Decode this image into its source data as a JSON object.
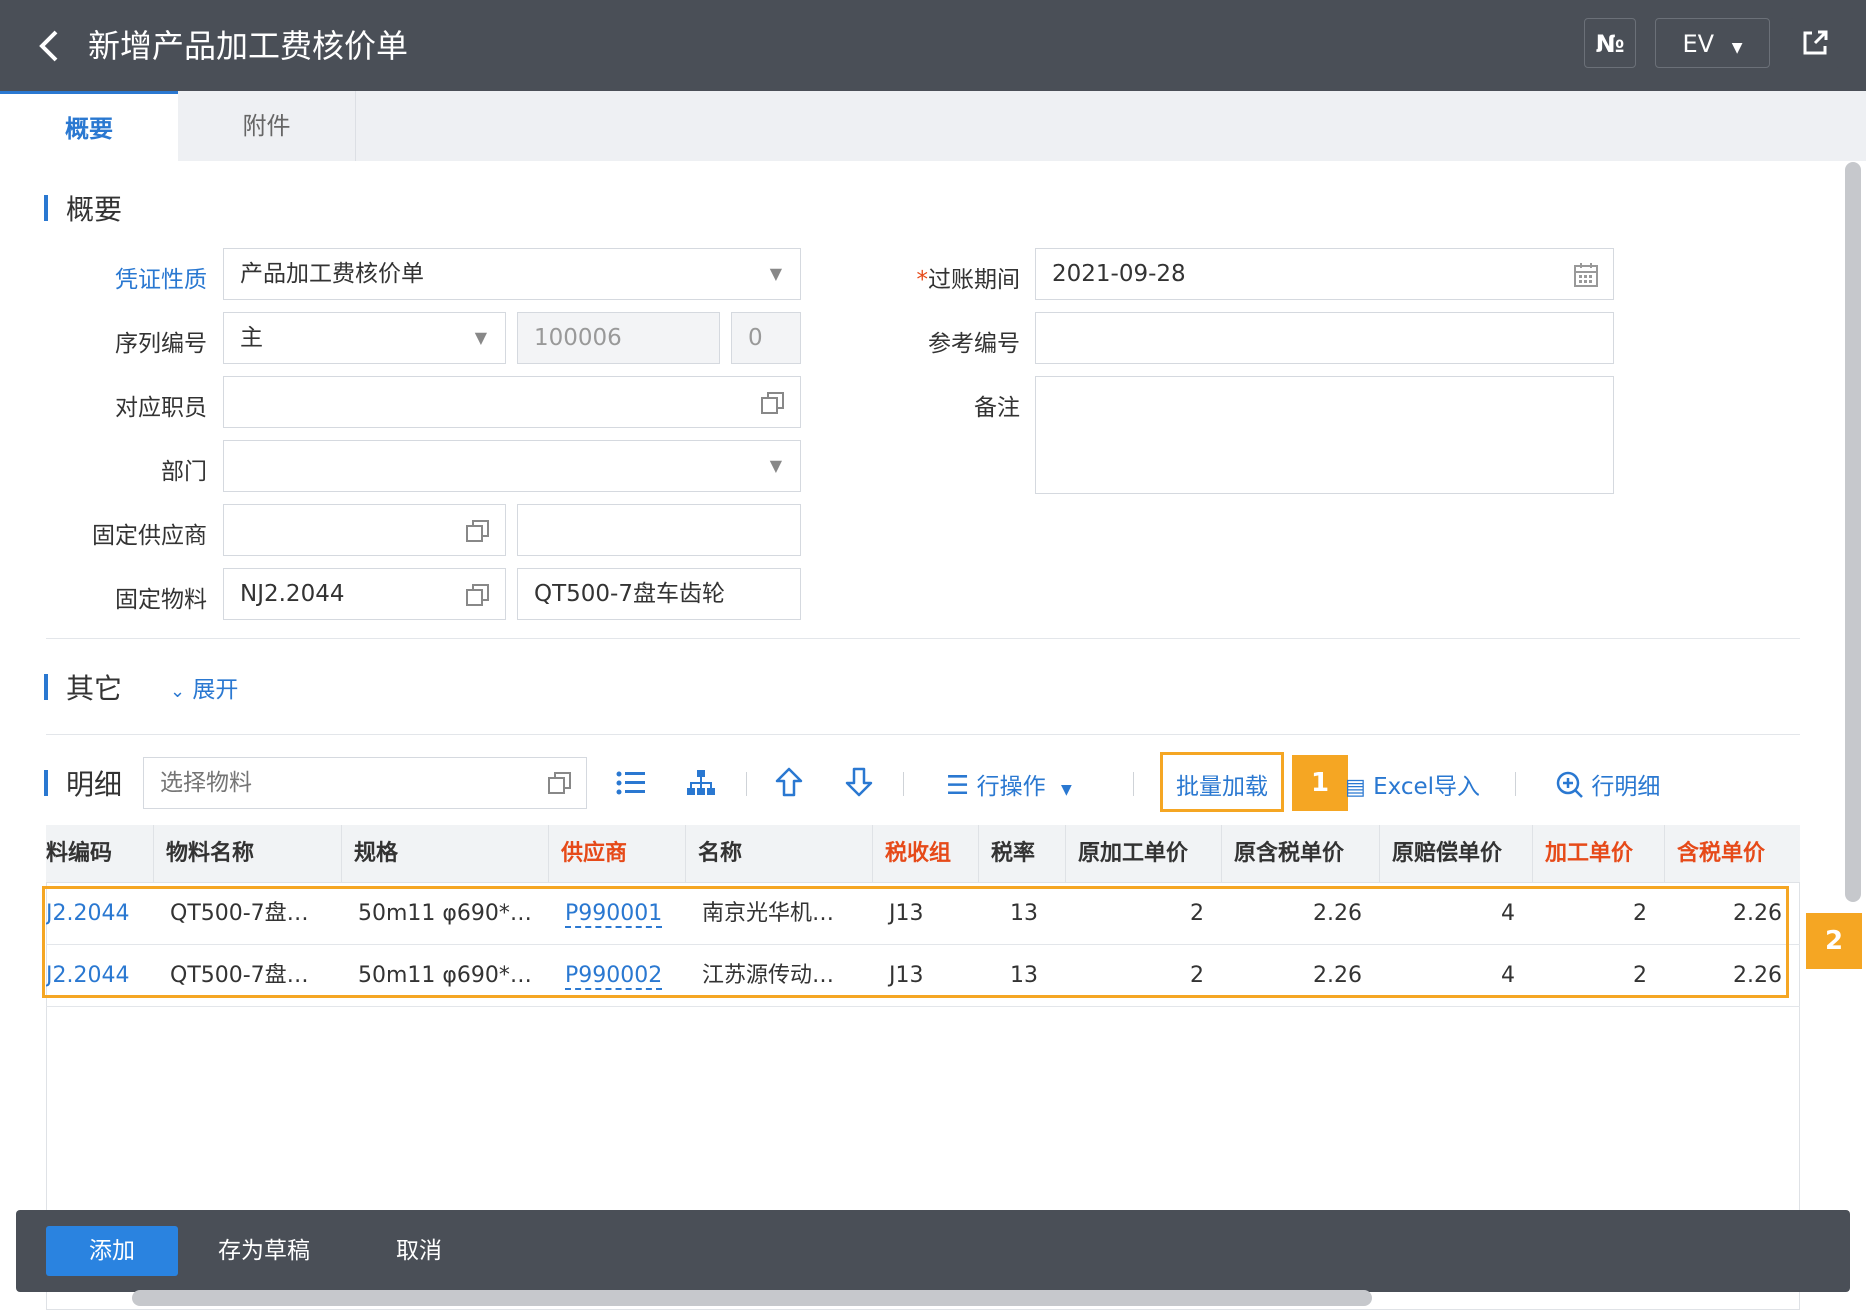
{
  "header": {
    "back_icon": "chevron-left-icon",
    "title": "新增产品加工费核价单",
    "num_button": "№",
    "ev_button": "EV",
    "external_icon": "external-link-icon"
  },
  "tabs": [
    {
      "label": "概要",
      "active": true
    },
    {
      "label": "附件",
      "active": false
    }
  ],
  "summary": {
    "title": "概要",
    "fields": {
      "voucher_type_label": "凭证性质",
      "voucher_type_value": "产品加工费核价单",
      "serial_label": "序列编号",
      "serial_value": "主",
      "serial_number": "100006",
      "serial_suffix": "0",
      "employee_label": "对应职员",
      "employee_value": "",
      "dept_label": "部门",
      "dept_value": "",
      "supplier_label": "固定供应商",
      "supplier_code": "",
      "supplier_name": "",
      "material_label": "固定物料",
      "material_code": "NJ2.2044",
      "material_name": "QT500-7盘车齿轮",
      "period_label_star": "*",
      "period_label": "过账期间",
      "period_value": "2021-09-28",
      "ref_label": "参考编号",
      "ref_value": "",
      "remark_label": "备注",
      "remark_value": ""
    }
  },
  "other": {
    "title": "其它",
    "expand_label": "展开"
  },
  "detail": {
    "title": "明细",
    "material_placeholder": "选择物料",
    "row_ops_label": "行操作",
    "batch_load_label": "批量加载",
    "excel_import_label": "Excel导入",
    "row_detail_label": "行明细"
  },
  "table": {
    "columns": [
      "料编码",
      "物料名称",
      "规格",
      "供应商",
      "名称",
      "税收组",
      "税率",
      "原加工单价",
      "原含税单价",
      "原赔偿单价",
      "加工单价",
      "含税单价"
    ],
    "rows": [
      [
        "J2.2044",
        "QT500-7盘…",
        "50m11 φ690*…",
        "P990001",
        "南京光华机…",
        "J13",
        "13",
        "2",
        "2.26",
        "4",
        "2",
        "2.26"
      ],
      [
        "J2.2044",
        "QT500-7盘…",
        "50m11 φ690*…",
        "P990002",
        "江苏源传动…",
        "J13",
        "13",
        "2",
        "2.26",
        "4",
        "2",
        "2.26"
      ]
    ]
  },
  "annotations": {
    "badge1": "1",
    "badge2": "2",
    "highlight_color": "#f5a623"
  },
  "footer": {
    "add_label": "添加",
    "draft_label": "存为草稿",
    "cancel_label": "取消"
  },
  "colors": {
    "topbar": "#4a4f57",
    "accent": "#2a78d1",
    "required_red": "#e64a19"
  }
}
